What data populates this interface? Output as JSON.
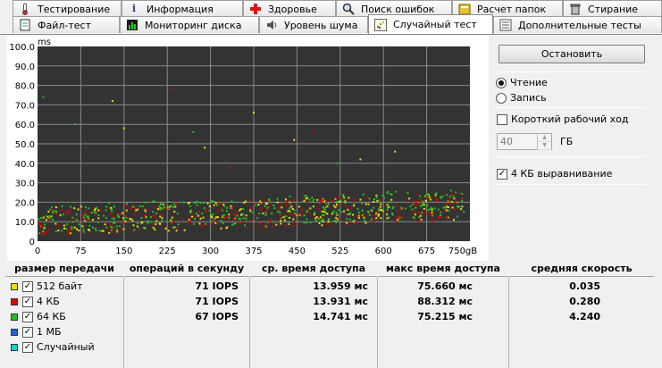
{
  "tabs_row1": [
    {
      "label": "Тестирование",
      "icon": "thermometer-icon"
    },
    {
      "label": "Информация",
      "icon": "info-icon"
    },
    {
      "label": "Здоровье",
      "icon": "health-cross-icon"
    },
    {
      "label": "Поиск ошибок",
      "icon": "magnifier-icon"
    },
    {
      "label": "Расчет папок",
      "icon": "folder-icon"
    },
    {
      "label": "Стирание",
      "icon": "trash-icon"
    }
  ],
  "tabs_row2": [
    {
      "label": "Файл-тест",
      "icon": "file-icon"
    },
    {
      "label": "Мониторинг диска",
      "icon": "monitor-chart-icon"
    },
    {
      "label": "Уровень шума",
      "icon": "speaker-icon"
    },
    {
      "label": "Случайный тест",
      "icon": "scatter-icon",
      "active": true
    },
    {
      "label": "Дополнительные тесты",
      "icon": "list-icon"
    }
  ],
  "controls": {
    "stop_label": "Остановить",
    "read_label": "Чтение",
    "write_label": "Запись",
    "read_selected": true,
    "short_stroke_label": "Короткий рабочий ход",
    "short_stroke_checked": false,
    "stroke_value": "40",
    "stroke_unit": "ГБ",
    "align_label": "4 КБ выравнивание",
    "align_checked": true
  },
  "table": {
    "headers": [
      "размер передачи",
      "операций в секунду",
      "ср. время доступа",
      "макс время доступа",
      "средняя скорость"
    ],
    "rows": [
      {
        "label": "512 байт",
        "color": "#f0e000",
        "checked": true,
        "iops": "71 IOPS",
        "avg": "13.959 мс",
        "max": "75.660 мс",
        "speed": "0.035"
      },
      {
        "label": "4 КБ",
        "color": "#e00000",
        "checked": true,
        "iops": "71 IOPS",
        "avg": "13.931 мс",
        "max": "88.312 мс",
        "speed": "0.280"
      },
      {
        "label": "64 КБ",
        "color": "#22c022",
        "checked": true,
        "iops": "67 IOPS",
        "avg": "14.741 мс",
        "max": "75.215 мс",
        "speed": "4.240"
      },
      {
        "label": "1 МБ",
        "color": "#2060e0",
        "checked": true,
        "iops": "",
        "avg": "",
        "max": "",
        "speed": ""
      },
      {
        "label": "Случайный",
        "color": "#20d0d0",
        "checked": true,
        "iops": "",
        "avg": "",
        "max": "",
        "speed": ""
      }
    ]
  },
  "chart_data": {
    "type": "scatter",
    "ylabel": "ms",
    "xlabel": "",
    "x_unit_suffix": "gB",
    "ylim": [
      0,
      100
    ],
    "xlim": [
      0,
      750
    ],
    "yticks": [
      "0",
      "10.0",
      "20.0",
      "30.0",
      "40.0",
      "50.0",
      "60.0",
      "70.0",
      "80.0",
      "90.0",
      "100.0"
    ],
    "xticks": [
      "0",
      "75",
      "150",
      "225",
      "300",
      "375",
      "450",
      "525",
      "600",
      "675",
      "750gB"
    ],
    "grid": true,
    "background": "#333333",
    "series": [
      {
        "color": "#f0e000",
        "x_range": [
          0,
          740
        ],
        "y_base": [
          10,
          18
        ],
        "y_spread": 9,
        "count": 240,
        "outliers": [
          [
            130,
            72
          ],
          [
            150,
            58
          ],
          [
            290,
            48
          ],
          [
            375,
            66
          ],
          [
            445,
            52
          ],
          [
            560,
            42
          ],
          [
            620,
            46
          ]
        ]
      },
      {
        "color": "#e00000",
        "x_range": [
          0,
          740
        ],
        "y_base": [
          10,
          18
        ],
        "y_spread": 9,
        "count": 240,
        "outliers": [
          [
            230,
            78
          ],
          [
            480,
            56
          ],
          [
            335,
            38
          ]
        ]
      },
      {
        "color": "#22c022",
        "x_range": [
          0,
          740
        ],
        "y_base": [
          11,
          20
        ],
        "y_spread": 9,
        "count": 320,
        "outliers": [
          [
            10,
            74
          ],
          [
            65,
            60
          ],
          [
            270,
            56
          ],
          [
            520,
            40
          ]
        ]
      }
    ]
  }
}
